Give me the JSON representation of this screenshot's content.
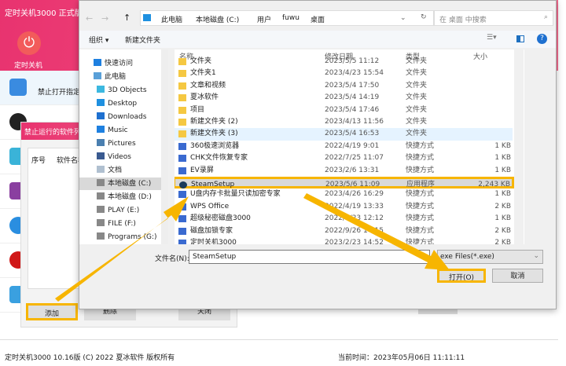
{
  "app": {
    "title": "定时关机3000 正式版",
    "power_label": "定时关机",
    "side_item1": "禁止打开指定",
    "status_left": "定时关机3000 10.16版 (C) 2022  夏冰软件 版权所有",
    "status_right": "当前时间：2023年05月06日 11:11:11"
  },
  "sub_dialog": {
    "title": "禁止运行的软件列",
    "col1": "序号",
    "col2": "软件名称",
    "add": "添加",
    "delete": "删除",
    "close": "关闭"
  },
  "dialog": {
    "breadcrumb": [
      "此电脑",
      "本地磁盘 (C:)",
      "用户",
      "fuwu",
      "桌面"
    ],
    "search_placeholder": "在 桌面 中搜索",
    "toolbar": {
      "organize": "组织 ▾",
      "new_folder": "新建文件夹"
    },
    "nav": [
      "快速访问",
      "此电脑",
      "3D Objects",
      "Desktop",
      "Downloads",
      "Music",
      "Pictures",
      "Videos",
      "文档",
      "本地磁盘 (C:)",
      "本地磁盘 (D:)",
      "PLAY (E:)",
      "FILE (F:)",
      "Programs (G:)"
    ],
    "columns": {
      "name": "名称",
      "date": "修改日期",
      "type": "类型",
      "size": "大小"
    },
    "files": [
      {
        "name": "文件夹",
        "date": "2023/5/5 11:12",
        "type": "文件夹",
        "size": ""
      },
      {
        "name": "文件夹1",
        "date": "2023/4/23 15:54",
        "type": "文件夹",
        "size": ""
      },
      {
        "name": "文章和视频",
        "date": "2023/5/4 17:50",
        "type": "文件夹",
        "size": ""
      },
      {
        "name": "夏冰软件",
        "date": "2023/5/4 14:19",
        "type": "文件夹",
        "size": ""
      },
      {
        "name": "项目",
        "date": "2023/5/4 17:46",
        "type": "文件夹",
        "size": ""
      },
      {
        "name": "新建文件夹 (2)",
        "date": "2023/4/13 11:56",
        "type": "文件夹",
        "size": ""
      },
      {
        "name": "新建文件夹 (3)",
        "date": "2023/5/4 16:53",
        "type": "文件夹",
        "size": ""
      },
      {
        "name": "360极速浏览器",
        "date": "2022/4/19 9:01",
        "type": "快捷方式",
        "size": "1 KB"
      },
      {
        "name": "CHK文件恢复专家",
        "date": "2022/7/25 11:07",
        "type": "快捷方式",
        "size": "1 KB"
      },
      {
        "name": "EV录屏",
        "date": "2023/2/6 13:31",
        "type": "快捷方式",
        "size": "1 KB"
      },
      {
        "name": "SteamSetup",
        "date": "2023/5/6 11:09",
        "type": "应用程序",
        "size": "2,243 KB"
      },
      {
        "name": "U盘内存卡批量只读加密专家",
        "date": "2023/4/26 16:29",
        "type": "快捷方式",
        "size": "1 KB"
      },
      {
        "name": "WPS Office",
        "date": "2022/4/19 13:33",
        "type": "快捷方式",
        "size": "2 KB"
      },
      {
        "name": "超级秘密磁盘3000",
        "date": "2022/6/23 12:12",
        "type": "快捷方式",
        "size": "1 KB"
      },
      {
        "name": "磁盘加锁专家",
        "date": "2022/9/26 14:15",
        "type": "快捷方式",
        "size": "2 KB"
      },
      {
        "name": "定时关机3000",
        "date": "2023/2/23 14:52",
        "type": "快捷方式",
        "size": "2 KB"
      }
    ],
    "filename_label": "文件名(N):",
    "filename_value": "SteamSetup",
    "filter": "exe Files(*.exe)",
    "open": "打开(O)",
    "cancel": "取消"
  },
  "colors": {
    "accent": "#e8336f",
    "highlight": "#f7b500",
    "selected": "#cce8ff"
  }
}
